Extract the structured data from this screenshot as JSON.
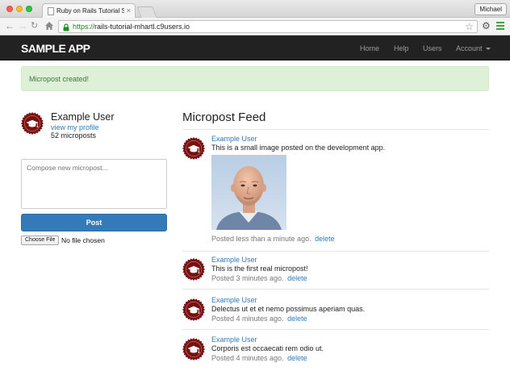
{
  "browser": {
    "tab_title": "Ruby on Rails Tutorial Samp",
    "tab_close": "×",
    "profile_name": "Michael",
    "url_scheme": "https://",
    "url_rest": "rails-tutorial-mhartl.c9users.io"
  },
  "header": {
    "logo": "SAMPLE APP",
    "nav": {
      "home": "Home",
      "help": "Help",
      "users": "Users",
      "account": "Account"
    }
  },
  "flash": {
    "message": "Micropost created!",
    "color": "#dff0d8",
    "text_color": "#3c763d"
  },
  "sidebar": {
    "user_name": "Example User",
    "profile_link": "view my profile",
    "micropost_count": "52 microposts",
    "compose_placeholder": "Compose new micropost...",
    "post_button": "Post",
    "choose_file_button": "Choose File",
    "no_file_label": "No file chosen"
  },
  "feed": {
    "title": "Micropost Feed",
    "delete_label": "delete",
    "items": [
      {
        "user": "Example User",
        "content": "This is a small image posted on the development app.",
        "time": "Posted less than a minute ago."
      },
      {
        "user": "Example User",
        "content": "This is the first real micropost!",
        "time": "Posted 3 minutes ago."
      },
      {
        "user": "Example User",
        "content": "Delectus ut et et nemo possimus aperiam quas.",
        "time": "Posted 4 minutes ago."
      },
      {
        "user": "Example User",
        "content": "Corporis est occaecati rem odio ut.",
        "time": "Posted 4 minutes ago."
      }
    ]
  },
  "colors": {
    "navbar": "#222222",
    "link": "#337ab7",
    "primary_button": "#337ab7",
    "avatar": "#7a0f10"
  },
  "icons": {
    "back": "arrow-left-icon",
    "forward": "arrow-right-icon",
    "reload": "reload-icon",
    "home": "home-icon",
    "lock": "lock-icon",
    "bookmark": "star-icon",
    "settings": "gear-icon",
    "menu": "hamburger-menu-icon",
    "avatar": "gravatar-default-icon"
  }
}
